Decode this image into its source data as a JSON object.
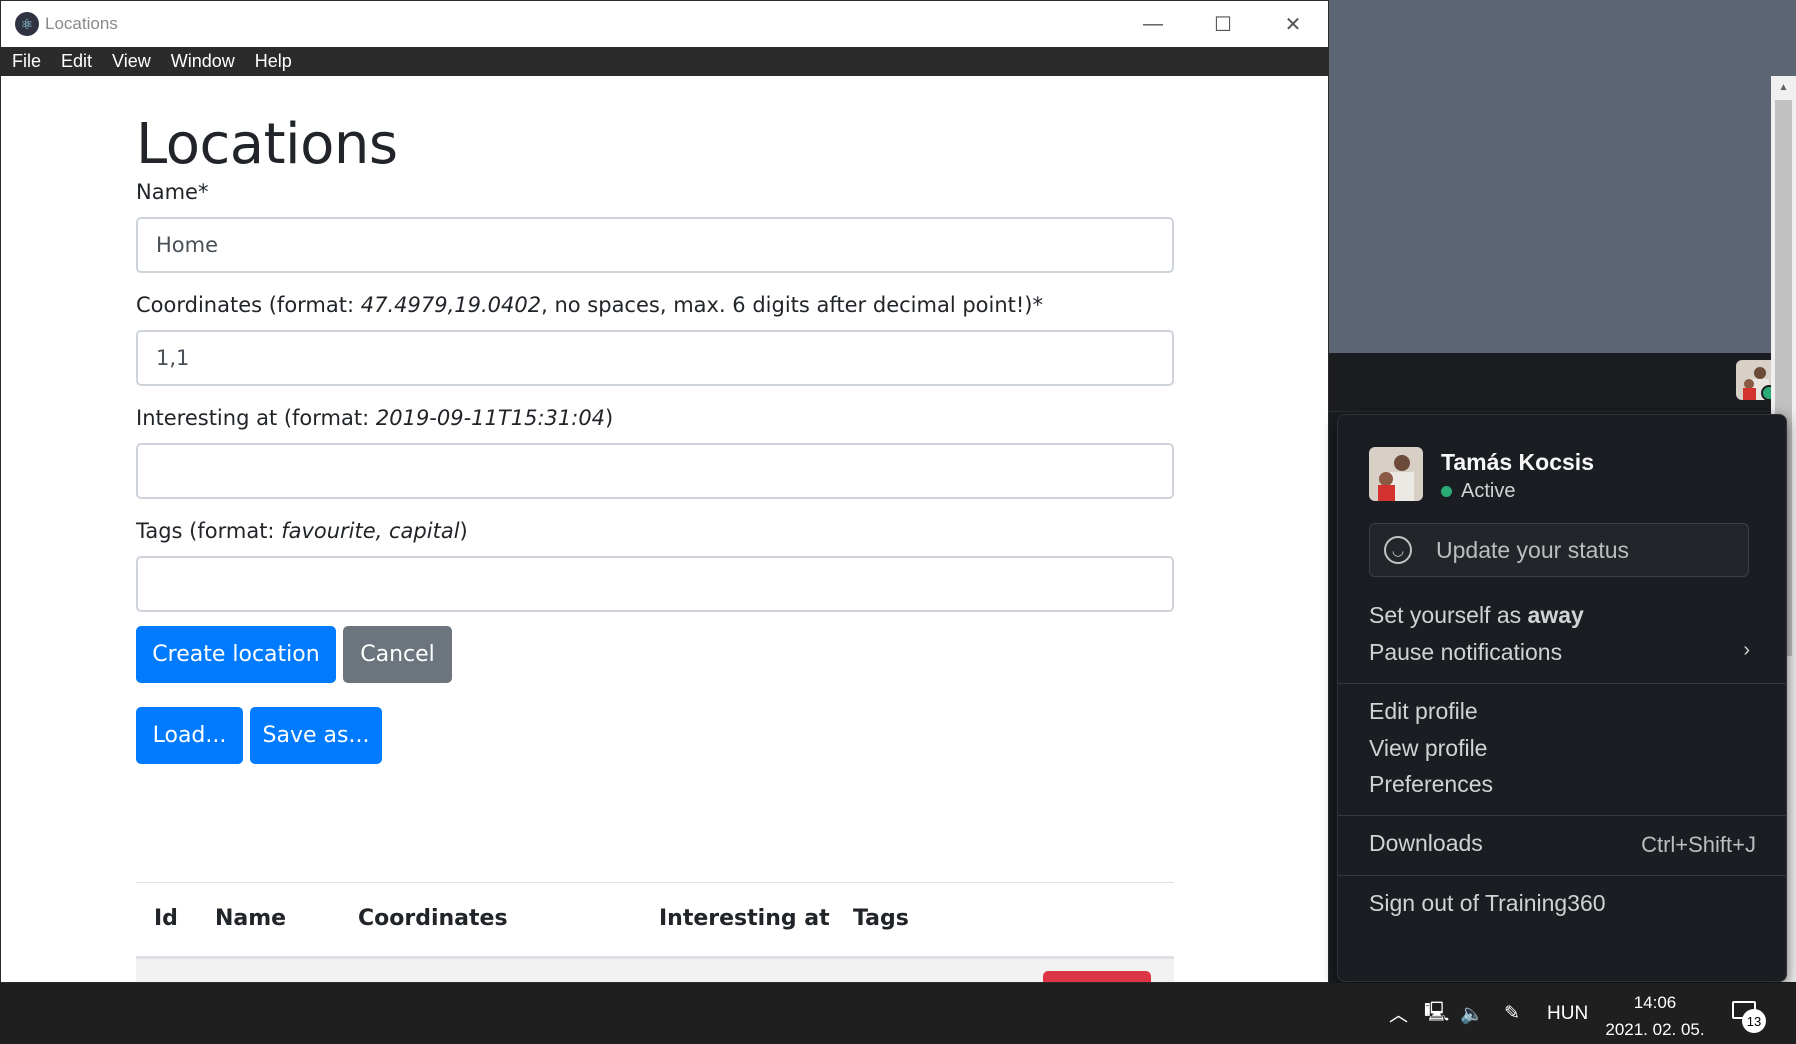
{
  "window": {
    "title": "Locations",
    "menu": [
      "File",
      "Edit",
      "View",
      "Window",
      "Help"
    ],
    "controls": {
      "minimize": "—",
      "maximize": "☐",
      "close": "✕"
    }
  },
  "page": {
    "heading": "Locations",
    "name": {
      "label": "Name*",
      "value": "Home"
    },
    "coordinates": {
      "label_prefix": "Coordinates (format: ",
      "label_example": "47.4979,19.0402",
      "label_suffix": ", no spaces, max. 6 digits after decimal point!)*",
      "value": "1,1"
    },
    "interesting_at": {
      "label_prefix": "Interesting at (format: ",
      "label_example": "2019-09-11T15:31:04",
      "label_suffix": ")",
      "value": ""
    },
    "tags": {
      "label_prefix": "Tags (format: ",
      "label_example": "favourite, capital",
      "label_suffix": ")",
      "value": ""
    },
    "buttons": {
      "create": "Create location",
      "cancel": "Cancel",
      "load": "Load...",
      "save_as": "Save as..."
    },
    "table": {
      "headers": [
        "Id",
        "Name",
        "Coordinates",
        "Interesting at",
        "Tags"
      ]
    }
  },
  "slack_menu": {
    "user_name": "Tamás Kocsis",
    "presence": "Active",
    "status_placeholder": "Update your status",
    "away_prefix": "Set yourself as ",
    "away_bold": "away",
    "pause_notifications": "Pause notifications",
    "edit_profile": "Edit profile",
    "view_profile": "View profile",
    "preferences": "Preferences",
    "downloads": "Downloads",
    "downloads_shortcut": "Ctrl+Shift+J",
    "sign_out": "Sign out of Training360"
  },
  "taskbar": {
    "language": "HUN",
    "time": "14:06",
    "date": "2021. 02. 05.",
    "notification_count": "13"
  },
  "colors": {
    "primary": "#007bff",
    "secondary": "#6c757d",
    "danger": "#dc3545",
    "slack_bg": "#1a1d21",
    "presence_green": "#2bac76"
  }
}
